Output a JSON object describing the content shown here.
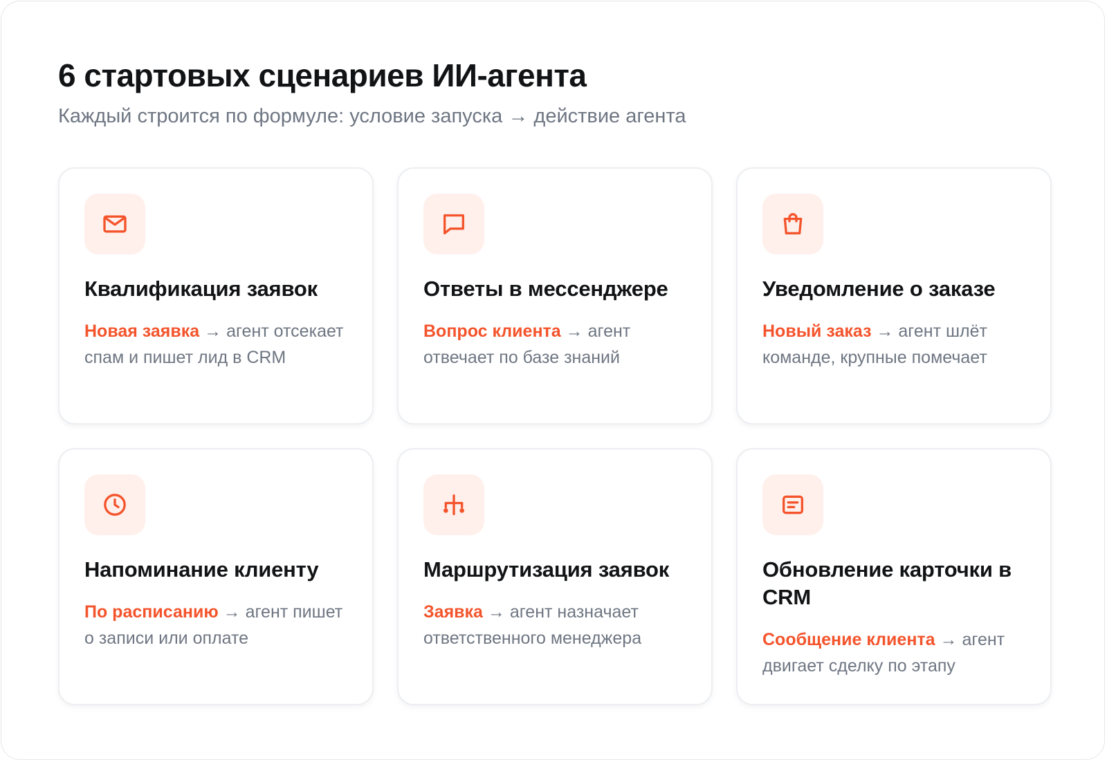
{
  "header": {
    "title": "6 стартовых сценариев ИИ-агента",
    "subtitle": "Каждый строится по формуле: условие запуска → действие агента"
  },
  "colors": {
    "accent": "#f4542c",
    "icon_background": "#fff0ec",
    "title_text": "#111315",
    "body_text": "#6e7682"
  },
  "cards": [
    {
      "icon": "mail-icon",
      "title": "Квалификация заявок",
      "trigger": "Новая заявка",
      "action": " → агент отсекает спам и пишет лид в CRM"
    },
    {
      "icon": "chat-icon",
      "title": "Ответы в мессенджере",
      "trigger": "Вопрос клиента",
      "action": " → агент отвечает по базе знаний"
    },
    {
      "icon": "shopping-bag-icon",
      "title": "Уведомление о заказе",
      "trigger": "Новый заказ",
      "action": " → агент шлёт команде, крупные помечает"
    },
    {
      "icon": "clock-icon",
      "title": "Напоминание клиенту",
      "trigger": "По расписанию",
      "action": " → агент пишет о записи или оплате"
    },
    {
      "icon": "route-split-icon",
      "title": "Маршрутизация заявок",
      "trigger": "Заявка",
      "action": " → агент назначает ответственного менеджера"
    },
    {
      "icon": "crm-card-icon",
      "title": "Обновление карточки в CRM",
      "trigger": "Сообщение клиента",
      "action": " → агент двигает сделку по этапу"
    }
  ]
}
